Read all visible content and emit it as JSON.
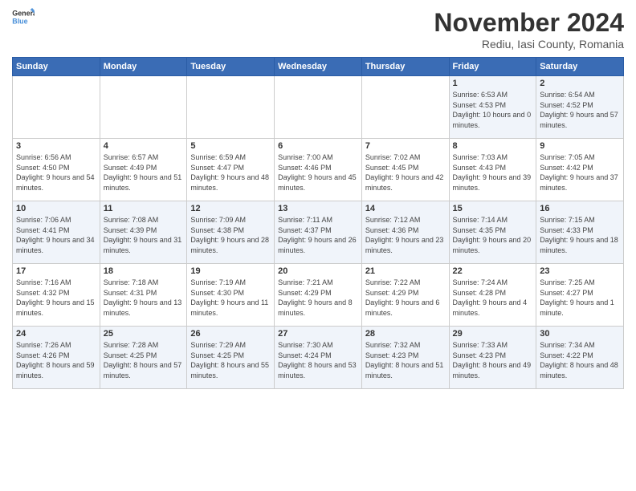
{
  "logo": {
    "text_general": "General",
    "text_blue": "Blue"
  },
  "header": {
    "title": "November 2024",
    "subtitle": "Rediu, Iasi County, Romania"
  },
  "weekdays": [
    "Sunday",
    "Monday",
    "Tuesday",
    "Wednesday",
    "Thursday",
    "Friday",
    "Saturday"
  ],
  "weeks": [
    [
      {
        "day": "",
        "info": ""
      },
      {
        "day": "",
        "info": ""
      },
      {
        "day": "",
        "info": ""
      },
      {
        "day": "",
        "info": ""
      },
      {
        "day": "",
        "info": ""
      },
      {
        "day": "1",
        "info": "Sunrise: 6:53 AM\nSunset: 4:53 PM\nDaylight: 10 hours and 0 minutes."
      },
      {
        "day": "2",
        "info": "Sunrise: 6:54 AM\nSunset: 4:52 PM\nDaylight: 9 hours and 57 minutes."
      }
    ],
    [
      {
        "day": "3",
        "info": "Sunrise: 6:56 AM\nSunset: 4:50 PM\nDaylight: 9 hours and 54 minutes."
      },
      {
        "day": "4",
        "info": "Sunrise: 6:57 AM\nSunset: 4:49 PM\nDaylight: 9 hours and 51 minutes."
      },
      {
        "day": "5",
        "info": "Sunrise: 6:59 AM\nSunset: 4:47 PM\nDaylight: 9 hours and 48 minutes."
      },
      {
        "day": "6",
        "info": "Sunrise: 7:00 AM\nSunset: 4:46 PM\nDaylight: 9 hours and 45 minutes."
      },
      {
        "day": "7",
        "info": "Sunrise: 7:02 AM\nSunset: 4:45 PM\nDaylight: 9 hours and 42 minutes."
      },
      {
        "day": "8",
        "info": "Sunrise: 7:03 AM\nSunset: 4:43 PM\nDaylight: 9 hours and 39 minutes."
      },
      {
        "day": "9",
        "info": "Sunrise: 7:05 AM\nSunset: 4:42 PM\nDaylight: 9 hours and 37 minutes."
      }
    ],
    [
      {
        "day": "10",
        "info": "Sunrise: 7:06 AM\nSunset: 4:41 PM\nDaylight: 9 hours and 34 minutes."
      },
      {
        "day": "11",
        "info": "Sunrise: 7:08 AM\nSunset: 4:39 PM\nDaylight: 9 hours and 31 minutes."
      },
      {
        "day": "12",
        "info": "Sunrise: 7:09 AM\nSunset: 4:38 PM\nDaylight: 9 hours and 28 minutes."
      },
      {
        "day": "13",
        "info": "Sunrise: 7:11 AM\nSunset: 4:37 PM\nDaylight: 9 hours and 26 minutes."
      },
      {
        "day": "14",
        "info": "Sunrise: 7:12 AM\nSunset: 4:36 PM\nDaylight: 9 hours and 23 minutes."
      },
      {
        "day": "15",
        "info": "Sunrise: 7:14 AM\nSunset: 4:35 PM\nDaylight: 9 hours and 20 minutes."
      },
      {
        "day": "16",
        "info": "Sunrise: 7:15 AM\nSunset: 4:33 PM\nDaylight: 9 hours and 18 minutes."
      }
    ],
    [
      {
        "day": "17",
        "info": "Sunrise: 7:16 AM\nSunset: 4:32 PM\nDaylight: 9 hours and 15 minutes."
      },
      {
        "day": "18",
        "info": "Sunrise: 7:18 AM\nSunset: 4:31 PM\nDaylight: 9 hours and 13 minutes."
      },
      {
        "day": "19",
        "info": "Sunrise: 7:19 AM\nSunset: 4:30 PM\nDaylight: 9 hours and 11 minutes."
      },
      {
        "day": "20",
        "info": "Sunrise: 7:21 AM\nSunset: 4:29 PM\nDaylight: 9 hours and 8 minutes."
      },
      {
        "day": "21",
        "info": "Sunrise: 7:22 AM\nSunset: 4:29 PM\nDaylight: 9 hours and 6 minutes."
      },
      {
        "day": "22",
        "info": "Sunrise: 7:24 AM\nSunset: 4:28 PM\nDaylight: 9 hours and 4 minutes."
      },
      {
        "day": "23",
        "info": "Sunrise: 7:25 AM\nSunset: 4:27 PM\nDaylight: 9 hours and 1 minute."
      }
    ],
    [
      {
        "day": "24",
        "info": "Sunrise: 7:26 AM\nSunset: 4:26 PM\nDaylight: 8 hours and 59 minutes."
      },
      {
        "day": "25",
        "info": "Sunrise: 7:28 AM\nSunset: 4:25 PM\nDaylight: 8 hours and 57 minutes."
      },
      {
        "day": "26",
        "info": "Sunrise: 7:29 AM\nSunset: 4:25 PM\nDaylight: 8 hours and 55 minutes."
      },
      {
        "day": "27",
        "info": "Sunrise: 7:30 AM\nSunset: 4:24 PM\nDaylight: 8 hours and 53 minutes."
      },
      {
        "day": "28",
        "info": "Sunrise: 7:32 AM\nSunset: 4:23 PM\nDaylight: 8 hours and 51 minutes."
      },
      {
        "day": "29",
        "info": "Sunrise: 7:33 AM\nSunset: 4:23 PM\nDaylight: 8 hours and 49 minutes."
      },
      {
        "day": "30",
        "info": "Sunrise: 7:34 AM\nSunset: 4:22 PM\nDaylight: 8 hours and 48 minutes."
      }
    ]
  ]
}
